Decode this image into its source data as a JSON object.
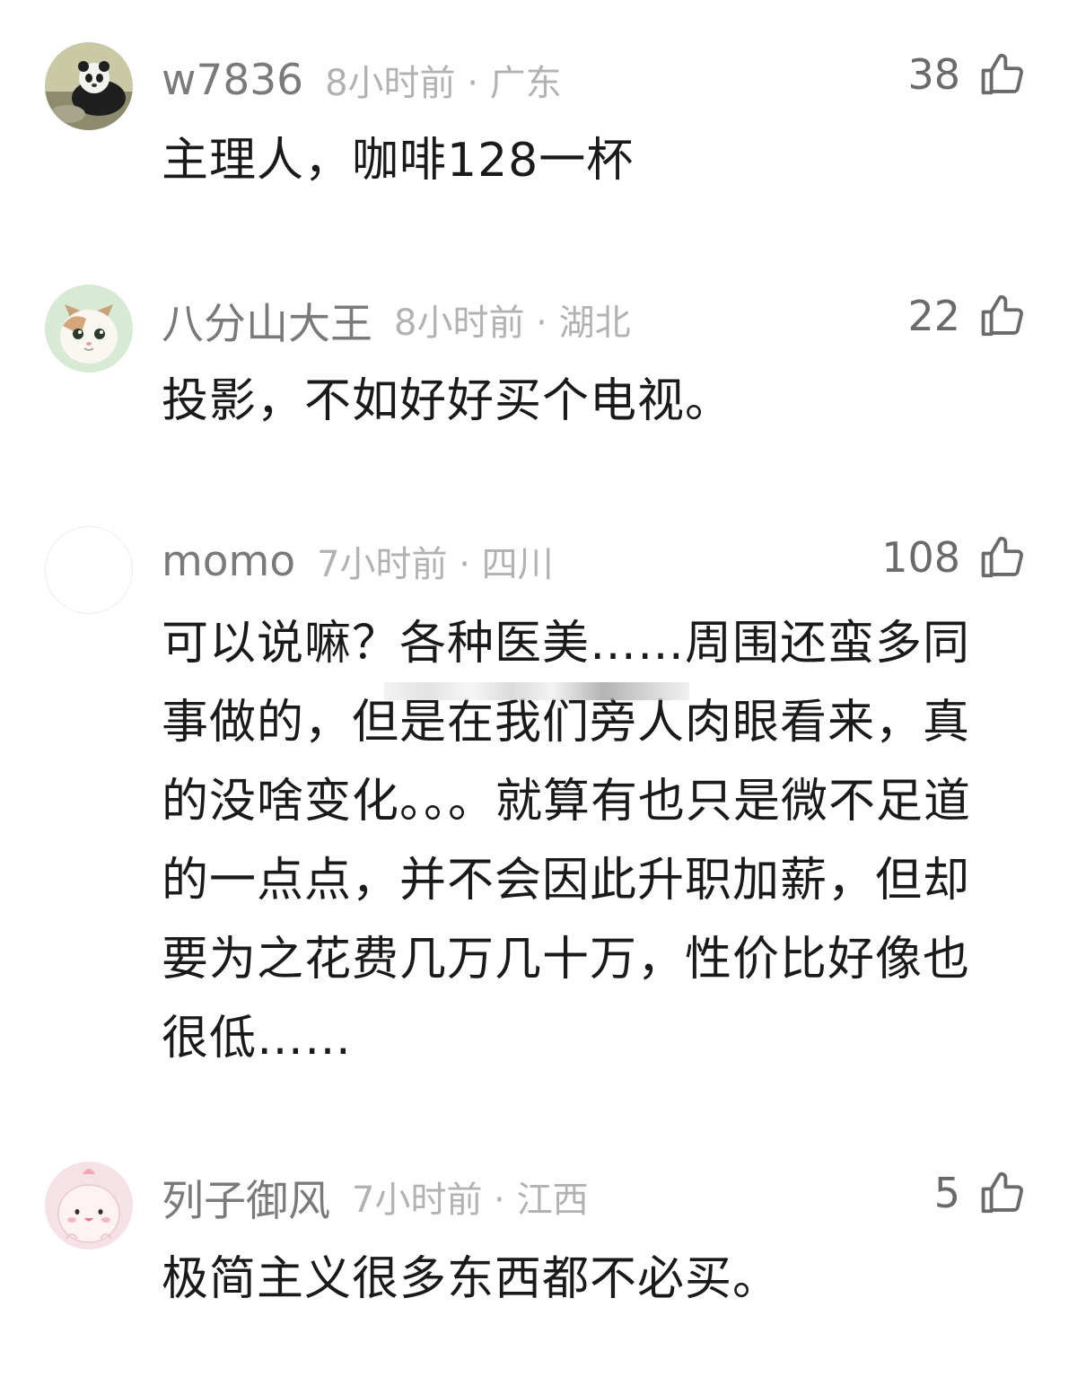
{
  "comments": [
    {
      "username": "w7836",
      "time_location": "8小时前 · 广东",
      "likes": "38",
      "text": "主理人，咖啡128一杯",
      "avatar_icon": "panda-avatar-icon"
    },
    {
      "username": "八分山大王",
      "time_location": "8小时前 · 湖北",
      "likes": "22",
      "text": "投影，不如好好买个电视。",
      "avatar_icon": "cat-avatar-icon"
    },
    {
      "username": "momo",
      "time_location": "7小时前 · 四川",
      "likes": "108",
      "text": "可以说嘛？各种医美……周围还蛮多同事做的，但是在我们旁人肉眼看来，真的没啥变化。。。就算有也只是微不足道的一点点，并不会因此升职加薪，但却要为之花费几万几十万，性价比好像也很低……",
      "avatar_icon": "blank-avatar-icon"
    },
    {
      "username": "列子御风",
      "time_location": "7小时前 · 江西",
      "likes": "5",
      "text": "极简主义很多东西都不必买。",
      "avatar_icon": "pink-blob-avatar-icon"
    }
  ],
  "like_icon": "thumbs-up-icon",
  "colors": {
    "username": "#7a7a7a",
    "meta": "#b2b2b2",
    "content": "#1a1a1a",
    "likes": "#6a6a6a"
  }
}
